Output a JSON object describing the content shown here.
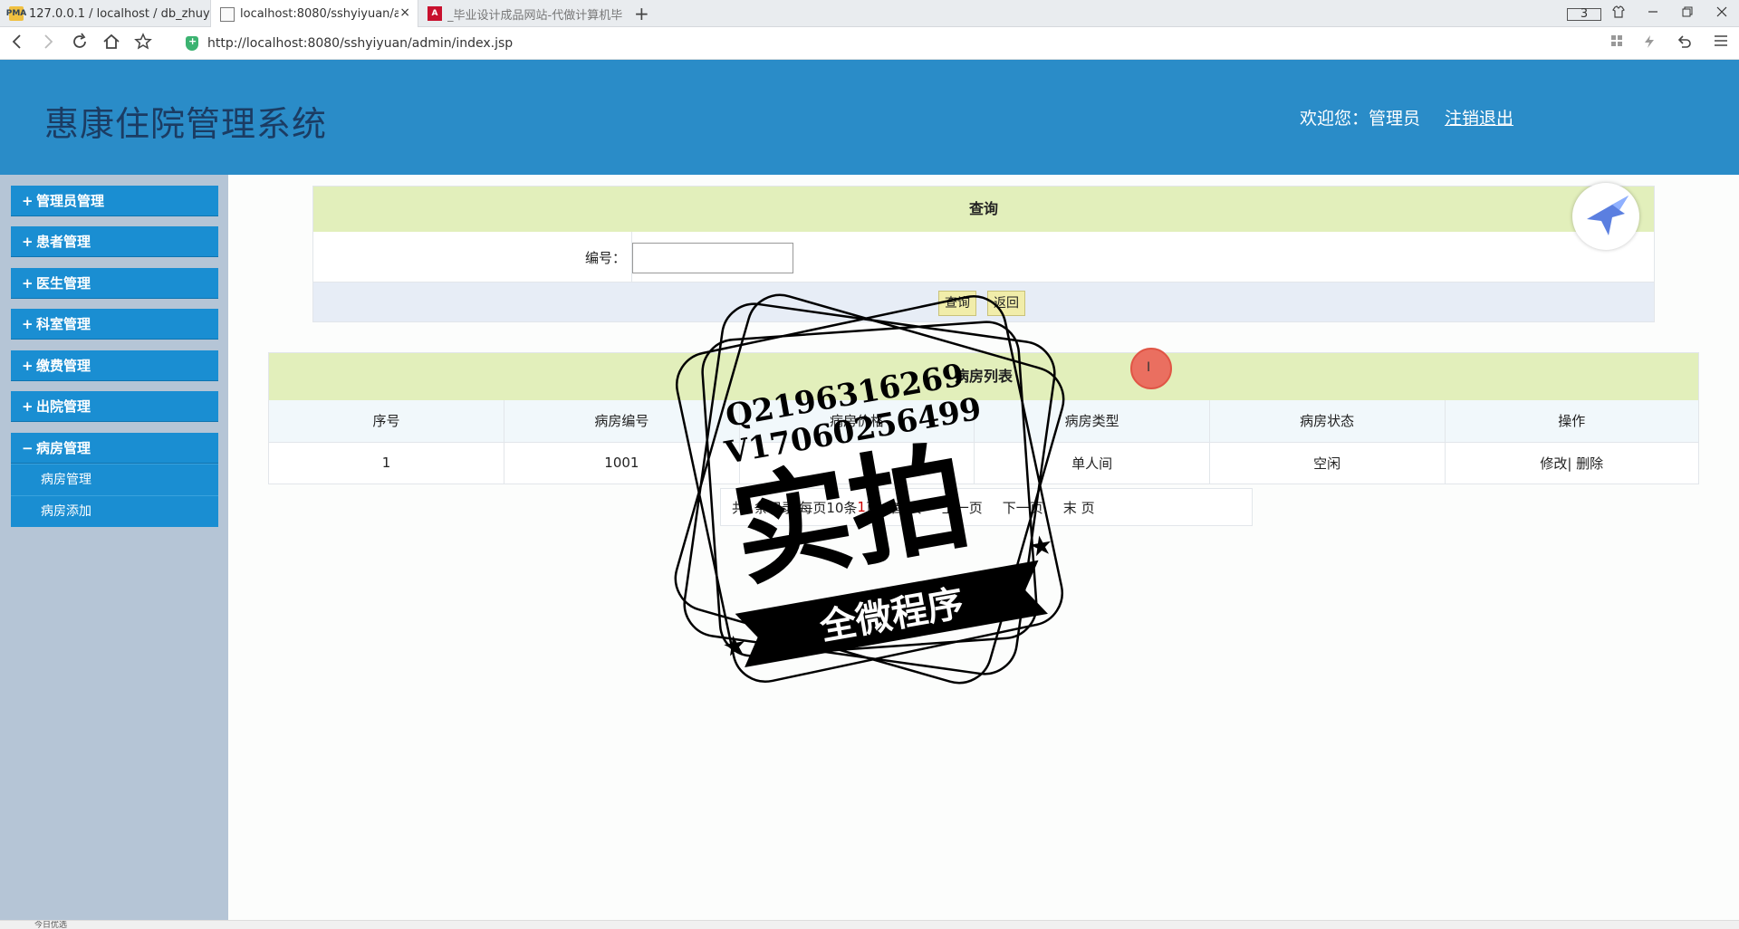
{
  "browser": {
    "tabs": [
      {
        "title": "127.0.0.1 / localhost / db_zhuy",
        "favicon": "PMA"
      },
      {
        "title": "localhost:8080/sshyiyuan/adm",
        "close": "×"
      },
      {
        "title": "_毕业设计成品网站-代做计算机毕",
        "favicon": "A"
      }
    ],
    "new_tab": "+",
    "tab_count": "3",
    "url": "http://localhost:8080/sshyiyuan/admin/index.jsp"
  },
  "header": {
    "title": "惠康住院管理系统",
    "welcome": "欢迎您：管理员",
    "logout": "注销退出"
  },
  "sidebar": {
    "items": [
      {
        "sign": "+",
        "label": "管理员管理"
      },
      {
        "sign": "+",
        "label": "患者管理"
      },
      {
        "sign": "+",
        "label": "医生管理"
      },
      {
        "sign": "+",
        "label": "科室管理"
      },
      {
        "sign": "+",
        "label": "缴费管理"
      },
      {
        "sign": "+",
        "label": "出院管理"
      },
      {
        "sign": "−",
        "label": "病房管理"
      }
    ],
    "subitems": [
      "病房管理",
      "病房添加"
    ]
  },
  "search": {
    "title": "查询",
    "field_label": "编号：",
    "field_value": "",
    "query_button": "查询",
    "back_button": "返回"
  },
  "list": {
    "title": "病房列表",
    "columns": [
      "序号",
      "病房编号",
      "病房价格",
      "病房类型",
      "病房状态",
      "操作"
    ],
    "rows": [
      {
        "index": "1",
        "code": "1001",
        "price": "",
        "type": "单人间",
        "status": "空闲",
        "edit": "修改",
        "sep": "|",
        "delete": " 删除"
      }
    ]
  },
  "pager": {
    "prefix": "共",
    "total": "1",
    "mid": "条记录 每页10条",
    "pages": "1",
    "suffix": "页",
    "current_prefix": "首 页",
    "links": [
      "上一页",
      "下一页",
      "末 页"
    ]
  },
  "watermark": {
    "line1": "Q2196316269",
    "line2": "V17060256499",
    "big": "实拍",
    "banner": "全微程序"
  },
  "status": {
    "text": "今日优选"
  },
  "colors": {
    "header_bg": "#2a8cc8",
    "menu_bg": "#1a8ed2",
    "sidebar_bg": "#b5c5d6",
    "panel_head": "#e2efbb"
  }
}
